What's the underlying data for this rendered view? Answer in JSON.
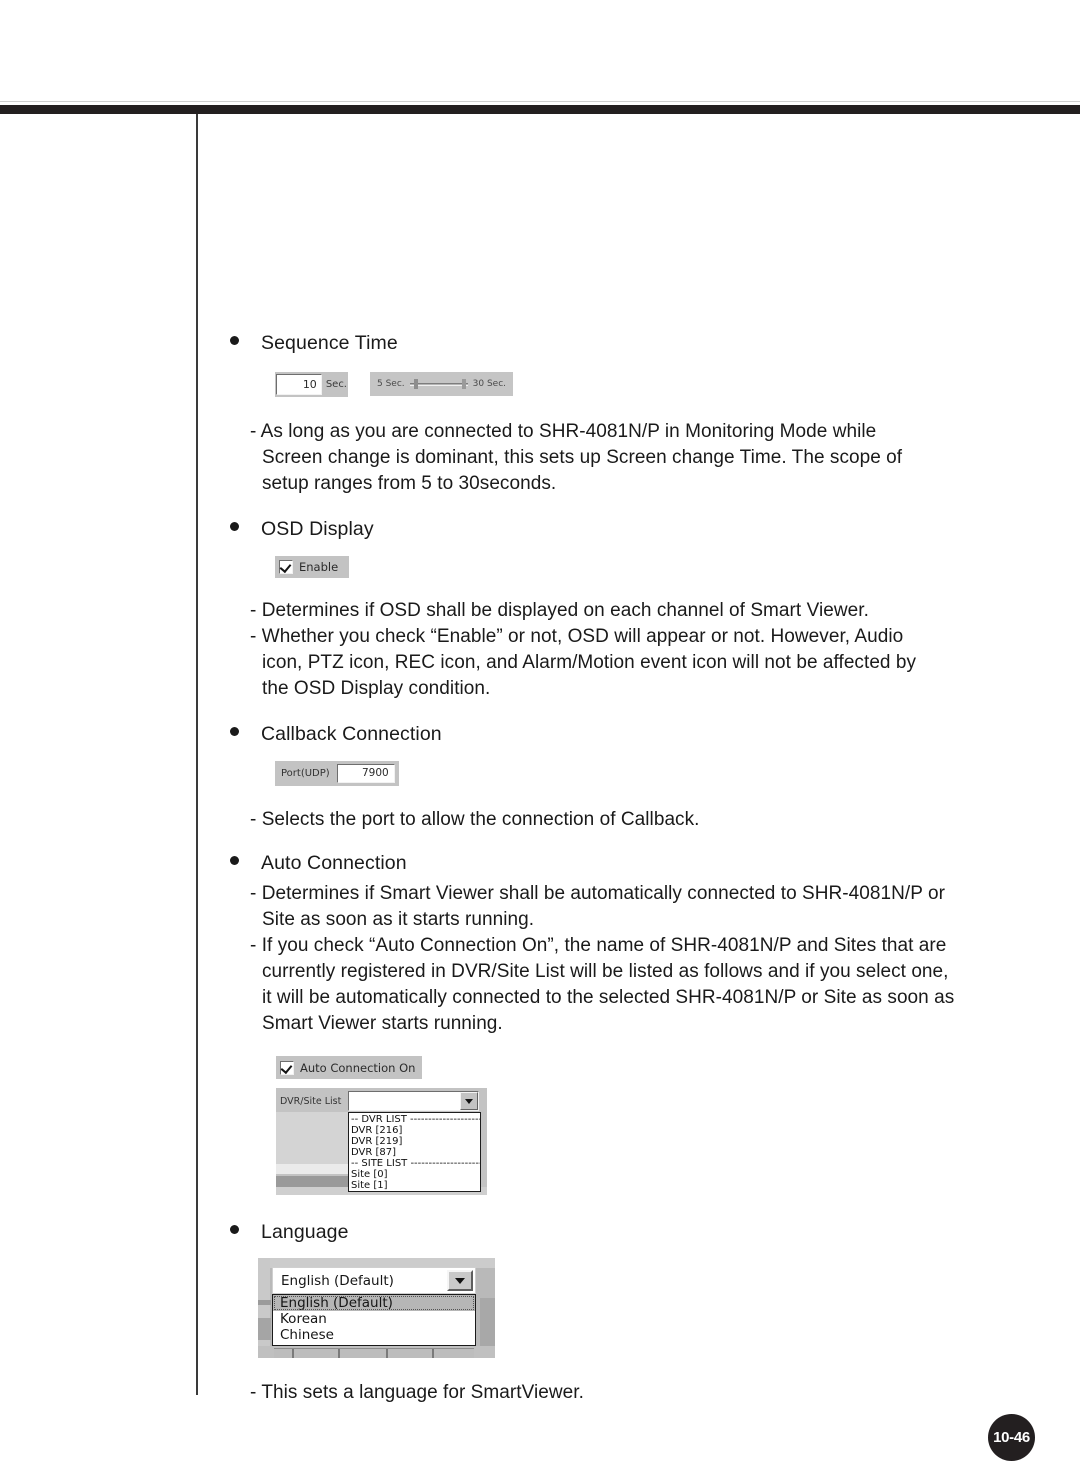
{
  "page": {
    "number": "10-46"
  },
  "sections": [
    {
      "heading": "Sequence Time",
      "widget": {
        "type": "sequence-time",
        "value": "10",
        "unit": "Sec.",
        "min_label": "5 Sec.",
        "max_label": "30 Sec."
      },
      "paragraphs": [
        "- As long as you are connected to SHR-4081N/P in Monitoring Mode while Screen change is dominant, this sets up Screen change Time. The scope of setup ranges from 5 to 30seconds."
      ]
    },
    {
      "heading": "OSD Display",
      "widget": {
        "type": "checkbox",
        "label": "Enable",
        "checked": true
      },
      "paragraphs": [
        "- Determines if OSD shall be displayed on each channel of Smart Viewer.",
        "- Whether you check “Enable” or not, OSD will appear or not. However, Audio icon, PTZ icon, REC icon, and Alarm/Motion event icon will not be affected by the OSD Display condition."
      ]
    },
    {
      "heading": "Callback Connection",
      "widget": {
        "type": "port-field",
        "label": "Port(UDP)",
        "value": "7900"
      },
      "paragraphs": [
        "- Selects the port to allow the connection of Callback."
      ]
    },
    {
      "heading": "Auto Connection",
      "paragraphs": [
        "- Determines if Smart Viewer shall be automatically connected to SHR-4081N/P or Site as soon as it starts running.",
        "- If you check “Auto Connection On”, the name of SHR-4081N/P and Sites that are currently registered in DVR/Site List will be listed as follows and if you select one, it will be automatically connected to the selected SHR-4081N/P or Site as soon as Smart Viewer starts running."
      ]
    },
    {
      "heading": "Language",
      "paragraphs": [
        "- This sets a language for SmartViewer."
      ]
    }
  ],
  "auto_connection_widget": {
    "checkbox_label": "Auto Connection On",
    "checkbox_checked": true,
    "combo_label": "DVR/Site List",
    "combo_value": "",
    "options": [
      "-- DVR LIST ----------------------",
      "DVR [216]",
      "DVR [219]",
      "DVR [87]",
      "-- SITE LIST ----------------------",
      "Site [0]",
      "Site [1]"
    ]
  },
  "language_widget": {
    "selected": "English (Default)",
    "options": [
      "English (Default)",
      "Korean",
      "Chinese"
    ]
  }
}
